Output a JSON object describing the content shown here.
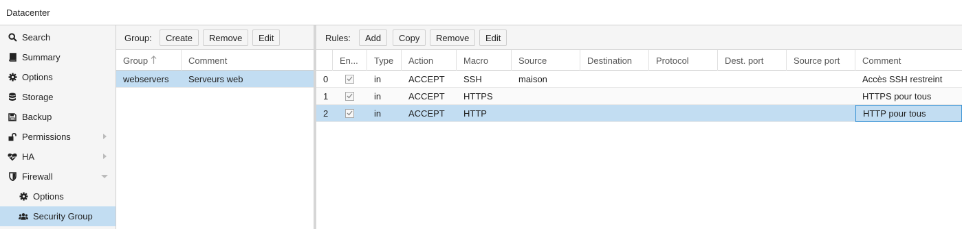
{
  "header": {
    "title": "Datacenter"
  },
  "nav": {
    "items": [
      {
        "label": "Search",
        "icon": "search-icon"
      },
      {
        "label": "Summary",
        "icon": "book-icon"
      },
      {
        "label": "Options",
        "icon": "gear-icon"
      },
      {
        "label": "Storage",
        "icon": "database-icon"
      },
      {
        "label": "Backup",
        "icon": "floppy-icon"
      },
      {
        "label": "Permissions",
        "icon": "unlock-icon"
      },
      {
        "label": "HA",
        "icon": "heartbeat-icon"
      },
      {
        "label": "Firewall",
        "icon": "shield-icon"
      },
      {
        "label": "Options",
        "icon": "gear-icon"
      },
      {
        "label": "Security Group",
        "icon": "users-icon"
      }
    ]
  },
  "groups_panel": {
    "toolbar_label": "Group:",
    "create_label": "Create",
    "remove_label": "Remove",
    "edit_label": "Edit",
    "columns": {
      "group": "Group",
      "comment": "Comment"
    },
    "rows": [
      {
        "group": "webservers",
        "comment": "Serveurs web"
      }
    ]
  },
  "rules_panel": {
    "toolbar_label": "Rules:",
    "add_label": "Add",
    "copy_label": "Copy",
    "remove_label": "Remove",
    "edit_label": "Edit",
    "columns": {
      "enable": "En...",
      "type": "Type",
      "action": "Action",
      "macro": "Macro",
      "source": "Source",
      "destination": "Destination",
      "protocol": "Protocol",
      "dest_port": "Dest. port",
      "source_port": "Source port",
      "comment": "Comment"
    },
    "rows": [
      {
        "pos": "0",
        "type": "in",
        "action": "ACCEPT",
        "macro": "SSH",
        "source": "maison",
        "comment": "Accès SSH restreint"
      },
      {
        "pos": "1",
        "type": "in",
        "action": "ACCEPT",
        "macro": "HTTPS",
        "source": "",
        "comment": "HTTPS pour tous"
      },
      {
        "pos": "2",
        "type": "in",
        "action": "ACCEPT",
        "macro": "HTTP",
        "source": "",
        "comment": "HTTP pour tous"
      }
    ]
  },
  "colors": {
    "selection": "#c2ddf2",
    "focus_border": "#3892d4",
    "toolbar_bg": "#f5f5f5"
  }
}
